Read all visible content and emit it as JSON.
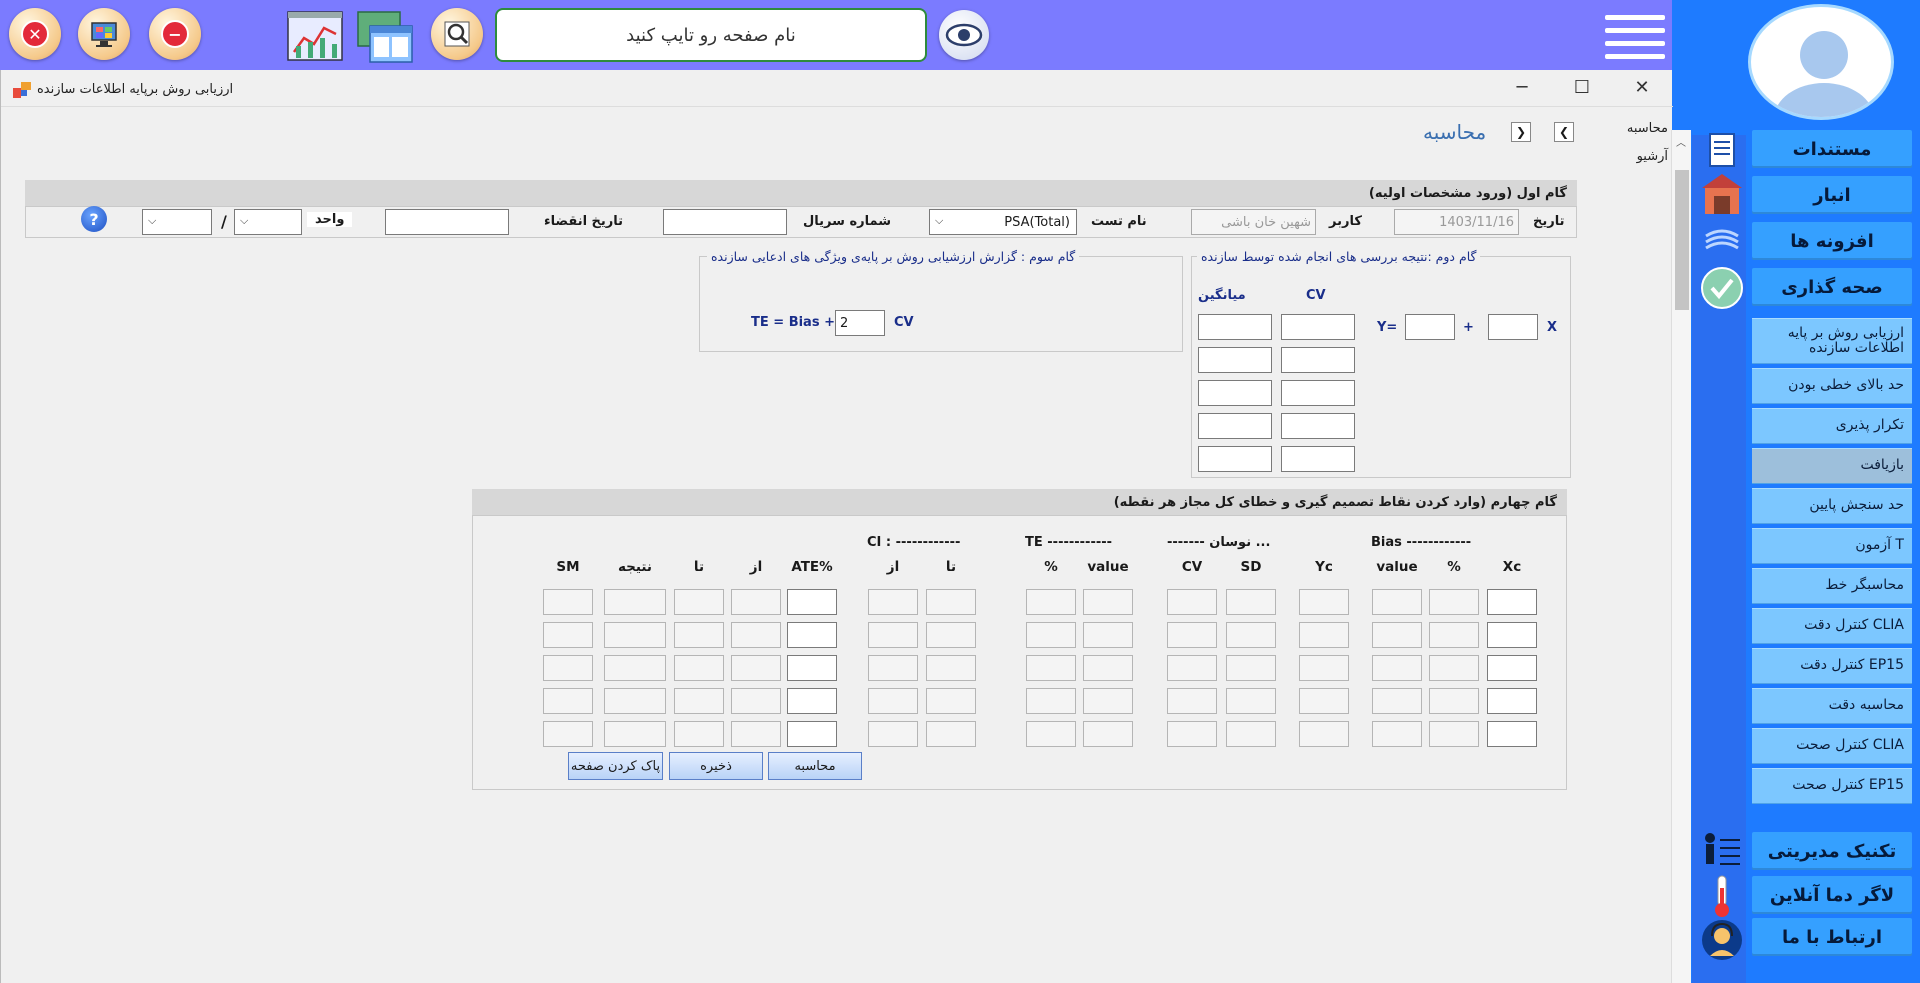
{
  "topbar": {
    "search_placeholder": "نام صفحه رو تایپ کنید",
    "buttons": [
      "close-app-icon",
      "monitor-icon",
      "minus-icon",
      "chart-icon",
      "window-icon",
      "zoom-icon",
      "eye-icon"
    ]
  },
  "window": {
    "title": "ارزیابی روش برپایه اطلاعات سازنده",
    "page_title": "محاسبه",
    "nav_tabs": [
      "محاسبه",
      "آرشیو"
    ]
  },
  "sidebar": {
    "main_items": [
      "مستندات",
      "انبار",
      "افزونه ها",
      "صحه گذاری"
    ],
    "sub_items": [
      "ارزیابی روش بر پایه اطلاعات سازنده",
      "حد بالای خطی بودن",
      "تکرار پذیری",
      "بازیافت",
      "حد سنجش پایین",
      "آزمون T",
      "محاسبگر خط",
      "کنترل دقت CLIA",
      "کنترل دقت EP15",
      "محاسبه دقت",
      "کنترل صحت CLIA",
      "کنترل صحت EP15"
    ],
    "bottom_items": [
      "تکنیک مدیریتی",
      "لاگر دما آنلاین",
      "ارتباط با ما"
    ],
    "active_sub": "بازیافت"
  },
  "step1": {
    "header": "گام اول (ورود مشخصات اولیه)",
    "date_label": "تاریخ",
    "date_value": "1403/11/16",
    "user_label": "کاربر",
    "user_value": "شهین خان باشی",
    "test_label": "نام تست",
    "test_value": "PSA(Total)",
    "serial_label": "شماره سریال",
    "expiry_label": "تاریخ انقضاء",
    "unit_label": "واحد",
    "unit_sep": "/"
  },
  "step2": {
    "legend": "گام دوم :نتیجه بررسی های انجام شده توسط سازنده",
    "col_cv": "CV",
    "col_mean": "میانگین",
    "eq_y": "Y=",
    "eq_plus": "+",
    "eq_x": "X"
  },
  "step3": {
    "legend": "گام سوم : گزارش ارزشیابی روش بر پایه‌ی ویژگی های ادعایی سازنده",
    "formula_left": "TE = Bias +",
    "multiplier": "2",
    "formula_right": "CV"
  },
  "step4": {
    "header": "گام چهارم (وارد کردن نقاط تصمیم گیری و خطای کل مجاز هر نقطه)",
    "groups": {
      "bias": "Bias ------------",
      "fluct": "------- نوسان ...",
      "te": "TE ------------",
      "ci": "CI : ------------"
    },
    "columns": {
      "xc": "Xc",
      "bias_pct": "%",
      "bias_value": "value",
      "yc": "Yc",
      "sd": "SD",
      "cv": "CV",
      "te_value": "value",
      "te_pct": "%",
      "ci_to": "تا",
      "ci_from": "از",
      "ate": "ATE%",
      "from": "از",
      "to": "تا",
      "result": "نتیجه",
      "sm": "SM"
    },
    "buttons": {
      "calculate": "محاسبه",
      "save": "ذخیره",
      "clear": "پاک کردن صفحه"
    }
  },
  "colors": {
    "topbar": "#7b7bff",
    "sidebar": "#1e7bff",
    "sidebar_main": "#35a0ff",
    "sidebar_sub": "#7cc7ff"
  }
}
